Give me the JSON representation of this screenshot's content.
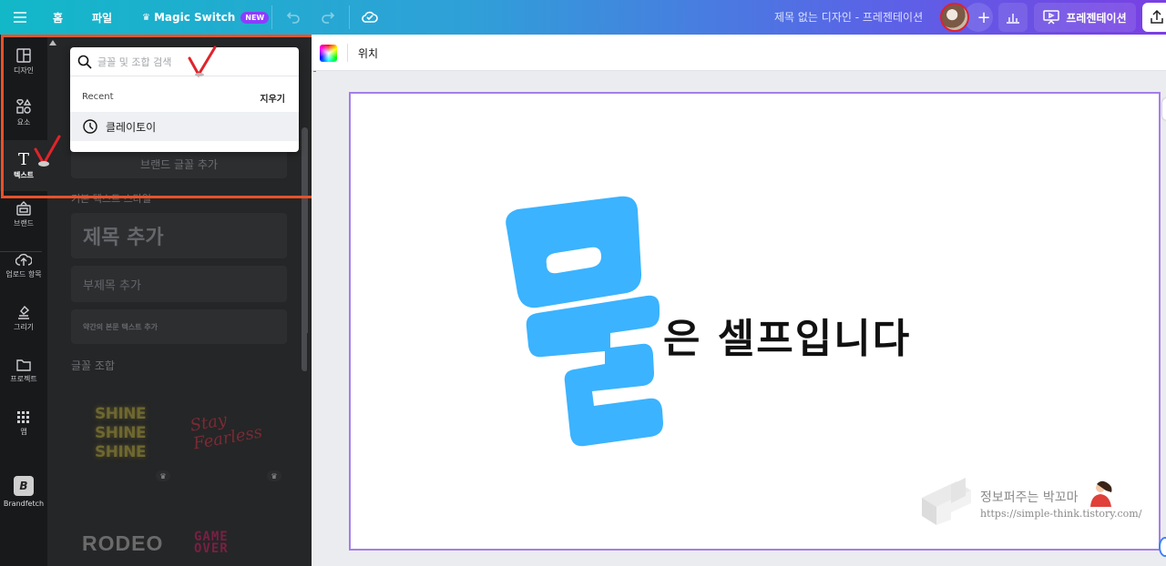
{
  "topbar": {
    "home_label": "홈",
    "file_label": "파일",
    "magic_switch_label": "Magic Switch",
    "new_badge": "NEW",
    "doc_title": "제목 없는 디자인 - 프레젠테이션",
    "present_label": "프레젠테이션"
  },
  "rail": {
    "items": [
      {
        "label": "디자인",
        "icon": "layout-icon"
      },
      {
        "label": "요소",
        "icon": "shapes-icon"
      },
      {
        "label": "텍스트",
        "icon": "text-icon"
      },
      {
        "label": "브랜드",
        "icon": "brand-icon"
      },
      {
        "label": "업로드 항목",
        "icon": "upload-cloud-icon"
      },
      {
        "label": "그리기",
        "icon": "draw-icon"
      },
      {
        "label": "프로젝트",
        "icon": "folder-icon"
      },
      {
        "label": "앱",
        "icon": "apps-grid-icon"
      },
      {
        "label": "Brandfetch",
        "icon": "brandfetch-icon",
        "logo_letter": "B"
      }
    ],
    "active_index": 2
  },
  "search": {
    "placeholder": "글꼴 및 조합 검색",
    "value": "",
    "recent_label": "Recent",
    "clear_label": "지우기",
    "recent_items": [
      "클레이토이"
    ]
  },
  "panel": {
    "brand_font_button": "브랜드 글꼴 추가",
    "default_styles_label": "기본 텍스트 스타일",
    "heading": "제목 추가",
    "subheading": "부제목 추가",
    "body": "약간의 본문 텍스트 추가",
    "font_combos_label": "글꼴 조합",
    "combos": [
      {
        "text": "SHINE\nSHINE\nSHINE",
        "premium": true
      },
      {
        "text": "Stay Fearless",
        "premium": true
      },
      {
        "text": "RODEO",
        "premium": false
      },
      {
        "text": "GAME OVER",
        "premium": false
      }
    ]
  },
  "context_bar": {
    "position_label": "위치"
  },
  "canvas": {
    "big_char": "물",
    "big_char_color": "#3bb3ff",
    "headline_rest": "은 셀프입니다",
    "watermark_title": "정보퍼주는 박꼬마",
    "watermark_url": "https://simple-think.tistory.com/"
  },
  "colors": {
    "highlight": "#e8522a",
    "checkmark": "#e0242b",
    "selection": "#a57ee8"
  }
}
